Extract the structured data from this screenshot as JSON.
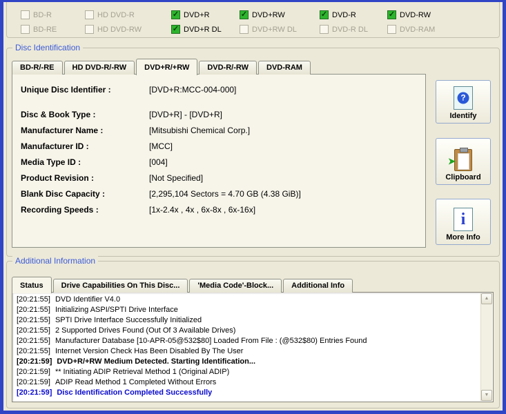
{
  "colors": {
    "frame_blue": "#3044C6",
    "background": "#ECE9D8",
    "panel": "#F7F5EA",
    "group_title_blue": "#3C5BD8",
    "checked_green": "#2EB42E",
    "log_highlight_blue": "#0B0BCE"
  },
  "icons": {
    "check": "✓",
    "question_mark": "?",
    "info_letter": "i",
    "clipboard_arrow": "➤",
    "scroll_up": "▲",
    "scroll_down": "▼"
  },
  "format_panel": {
    "items": [
      {
        "label": "BD-R",
        "checked": false,
        "enabled": false
      },
      {
        "label": "HD DVD-R",
        "checked": false,
        "enabled": false
      },
      {
        "label": "DVD+R",
        "checked": true,
        "enabled": true
      },
      {
        "label": "DVD+RW",
        "checked": true,
        "enabled": true
      },
      {
        "label": "DVD-R",
        "checked": true,
        "enabled": true
      },
      {
        "label": "DVD-RW",
        "checked": true,
        "enabled": true
      },
      {
        "label": "BD-RE",
        "checked": false,
        "enabled": false
      },
      {
        "label": "HD DVD-RW",
        "checked": false,
        "enabled": false
      },
      {
        "label": "DVD+R DL",
        "checked": true,
        "enabled": true
      },
      {
        "label": "DVD+RW DL",
        "checked": false,
        "enabled": false
      },
      {
        "label": "DVD-R DL",
        "checked": false,
        "enabled": false
      },
      {
        "label": "DVD-RAM",
        "checked": false,
        "enabled": false
      }
    ]
  },
  "disc_identification": {
    "title": "Disc Identification",
    "tabs": [
      {
        "label": "BD-R/-RE",
        "active": false
      },
      {
        "label": "HD DVD-R/-RW",
        "active": false
      },
      {
        "label": "DVD+R/+RW",
        "active": true
      },
      {
        "label": "DVD-R/-RW",
        "active": false
      },
      {
        "label": "DVD-RAM",
        "active": false
      }
    ],
    "fields": [
      {
        "label": "Unique Disc Identifier :",
        "value": "[DVD+R:MCC-004-000]"
      },
      {
        "label": "Disc & Book Type :",
        "value": "[DVD+R] - [DVD+R]"
      },
      {
        "label": "Manufacturer Name :",
        "value": "[Mitsubishi Chemical Corp.]"
      },
      {
        "label": "Manufacturer ID :",
        "value": "[MCC]"
      },
      {
        "label": "Media Type ID :",
        "value": "[004]"
      },
      {
        "label": "Product Revision :",
        "value": "[Not Specified]"
      },
      {
        "label": "Blank Disc Capacity :",
        "value": "[2,295,104 Sectors = 4.70 GB (4.38 GiB)]"
      },
      {
        "label": "Recording Speeds :",
        "value": "[1x-2.4x , 4x , 6x-8x , 6x-16x]"
      }
    ],
    "buttons": [
      {
        "label": "Identify"
      },
      {
        "label": "Clipboard"
      },
      {
        "label": "More Info"
      }
    ]
  },
  "additional_information": {
    "title": "Additional Information",
    "tabs": [
      {
        "label": "Status",
        "active": true
      },
      {
        "label": "Drive Capabilities On This Disc...",
        "active": false
      },
      {
        "label": "'Media Code'-Block...",
        "active": false
      },
      {
        "label": "Additional Info",
        "active": false
      }
    ],
    "log": [
      {
        "time": "[20:21:55]",
        "text": "DVD Identifier V4.0",
        "emphasis": "none"
      },
      {
        "time": "[20:21:55]",
        "text": "Initializing ASPI/SPTI Drive Interface",
        "emphasis": "none"
      },
      {
        "time": "[20:21:55]",
        "text": "SPTI Drive Interface Successfully Initialized",
        "emphasis": "none"
      },
      {
        "time": "[20:21:55]",
        "text": "2 Supported Drives Found (Out Of 3 Available Drives)",
        "emphasis": "none"
      },
      {
        "time": "[20:21:55]",
        "text": "Manufacturer Database [10-APR-05@532$80] Loaded From File : (@532$80) Entries Found",
        "emphasis": "none"
      },
      {
        "time": "[20:21:55]",
        "text": "Internet Version Check Has Been Disabled By The User",
        "emphasis": "none"
      },
      {
        "time": "[20:21:59]",
        "text": "DVD+R/+RW Medium Detected. Starting Identification...",
        "emphasis": "bold"
      },
      {
        "time": "[20:21:59]",
        "text": "** Initiating ADIP Retrieval Method 1 (Original ADIP)",
        "emphasis": "none"
      },
      {
        "time": "[20:21:59]",
        "text": "ADIP Read Method 1 Completed Without Errors",
        "emphasis": "none"
      },
      {
        "time": "[20:21:59]",
        "text": "Disc Identification Completed Successfully",
        "emphasis": "bold-blue"
      }
    ]
  }
}
